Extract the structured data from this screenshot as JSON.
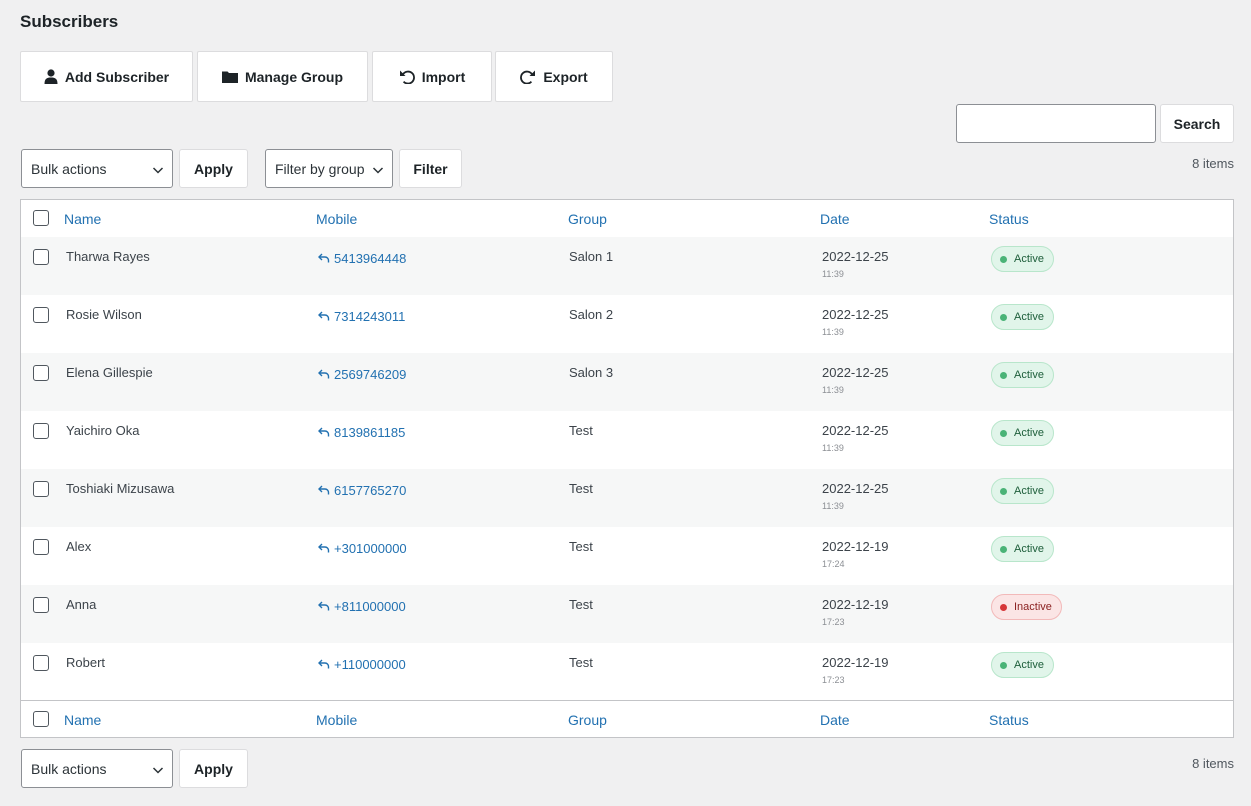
{
  "page": {
    "title": "Subscribers"
  },
  "toolbar": {
    "add_subscriber": "Add Subscriber",
    "manage_group": "Manage Group",
    "import": "Import",
    "export": "Export"
  },
  "search": {
    "button": "Search",
    "value": ""
  },
  "top_actions": {
    "bulk_actions": "Bulk actions",
    "apply": "Apply",
    "filter_group": "Filter by group",
    "filter": "Filter",
    "count": "8 items"
  },
  "bottom_actions": {
    "bulk_actions": "Bulk actions",
    "apply": "Apply",
    "count": "8 items"
  },
  "table": {
    "columns": [
      "Name",
      "Mobile",
      "Group",
      "Date",
      "Status"
    ],
    "rows": [
      {
        "name": "Tharwa Rayes",
        "mobile": "5413964448",
        "group": "Salon 1",
        "date": "2022-12-25",
        "time": "11:39",
        "status": "Active"
      },
      {
        "name": "Rosie Wilson",
        "mobile": "7314243011",
        "group": "Salon 2",
        "date": "2022-12-25",
        "time": "11:39",
        "status": "Active"
      },
      {
        "name": "Elena Gillespie",
        "mobile": "2569746209",
        "group": "Salon 3",
        "date": "2022-12-25",
        "time": "11:39",
        "status": "Active"
      },
      {
        "name": "Yaichiro Oka",
        "mobile": "8139861185",
        "group": "Test",
        "date": "2022-12-25",
        "time": "11:39",
        "status": "Active"
      },
      {
        "name": "Toshiaki Mizusawa",
        "mobile": "6157765270",
        "group": "Test",
        "date": "2022-12-25",
        "time": "11:39",
        "status": "Active"
      },
      {
        "name": "Alex",
        "mobile": "+301000000",
        "group": "Test",
        "date": "2022-12-19",
        "time": "17:24",
        "status": "Active"
      },
      {
        "name": "Anna",
        "mobile": "+811000000",
        "group": "Test",
        "date": "2022-12-19",
        "time": "17:23",
        "status": "Inactive"
      },
      {
        "name": "Robert",
        "mobile": "+110000000",
        "group": "Test",
        "date": "2022-12-19",
        "time": "17:23",
        "status": "Active"
      }
    ]
  },
  "colors": {
    "link": "#2271b1",
    "active_dot": "#4ab377",
    "inactive_dot": "#d63638",
    "background": "#f0f0f1"
  },
  "icons": {
    "add_subscriber": "user-icon",
    "manage_group": "folder-icon",
    "import": "undo-arrow-icon",
    "export": "redo-arrow-icon",
    "mobile": "reply-arrow-icon",
    "select": "chevron-down-icon"
  }
}
